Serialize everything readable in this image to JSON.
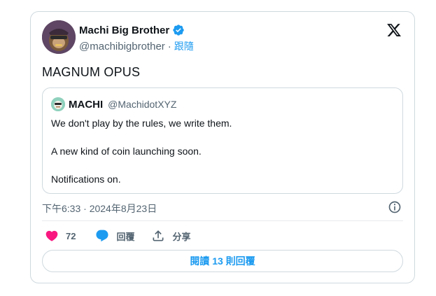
{
  "tweet": {
    "author": {
      "display_name": "Machi Big Brother",
      "handle": "@machibigbrother",
      "separator": "·",
      "follow_label": "跟隨",
      "verified_icon": "verified-badge-icon"
    },
    "text": "MAGNUM OPUS",
    "quote": {
      "display_name": "MACHI",
      "handle": "@MachidotXYZ",
      "lines": [
        "We don't play by the rules, we write them.",
        "A new kind of coin launching soon.",
        "Notifications on."
      ]
    },
    "timestamp": "下午6:33 · 2024年8月23日",
    "actions": {
      "like_count": "72",
      "reply_label": "回覆",
      "share_label": "分享"
    },
    "read_replies_label": "閱讀 13 則回覆"
  },
  "colors": {
    "accent": "#1d9bf0",
    "like": "#f91880",
    "border": "#cfd9de",
    "secondary_text": "#536471"
  }
}
